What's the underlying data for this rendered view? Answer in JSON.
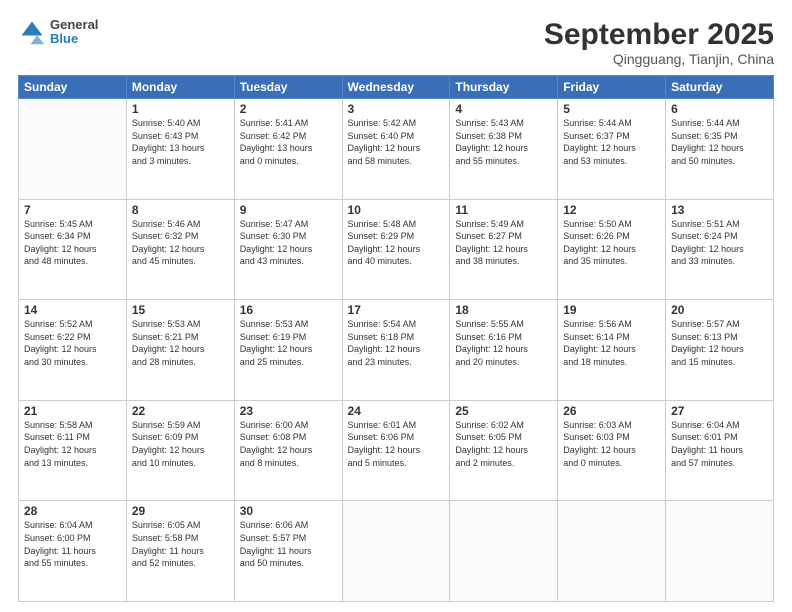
{
  "header": {
    "logo_line1": "General",
    "logo_line2": "Blue",
    "month": "September 2025",
    "location": "Qingguang, Tianjin, China"
  },
  "weekdays": [
    "Sunday",
    "Monday",
    "Tuesday",
    "Wednesday",
    "Thursday",
    "Friday",
    "Saturday"
  ],
  "weeks": [
    [
      {
        "day": "",
        "info": ""
      },
      {
        "day": "1",
        "info": "Sunrise: 5:40 AM\nSunset: 6:43 PM\nDaylight: 13 hours\nand 3 minutes."
      },
      {
        "day": "2",
        "info": "Sunrise: 5:41 AM\nSunset: 6:42 PM\nDaylight: 13 hours\nand 0 minutes."
      },
      {
        "day": "3",
        "info": "Sunrise: 5:42 AM\nSunset: 6:40 PM\nDaylight: 12 hours\nand 58 minutes."
      },
      {
        "day": "4",
        "info": "Sunrise: 5:43 AM\nSunset: 6:38 PM\nDaylight: 12 hours\nand 55 minutes."
      },
      {
        "day": "5",
        "info": "Sunrise: 5:44 AM\nSunset: 6:37 PM\nDaylight: 12 hours\nand 53 minutes."
      },
      {
        "day": "6",
        "info": "Sunrise: 5:44 AM\nSunset: 6:35 PM\nDaylight: 12 hours\nand 50 minutes."
      }
    ],
    [
      {
        "day": "7",
        "info": "Sunrise: 5:45 AM\nSunset: 6:34 PM\nDaylight: 12 hours\nand 48 minutes."
      },
      {
        "day": "8",
        "info": "Sunrise: 5:46 AM\nSunset: 6:32 PM\nDaylight: 12 hours\nand 45 minutes."
      },
      {
        "day": "9",
        "info": "Sunrise: 5:47 AM\nSunset: 6:30 PM\nDaylight: 12 hours\nand 43 minutes."
      },
      {
        "day": "10",
        "info": "Sunrise: 5:48 AM\nSunset: 6:29 PM\nDaylight: 12 hours\nand 40 minutes."
      },
      {
        "day": "11",
        "info": "Sunrise: 5:49 AM\nSunset: 6:27 PM\nDaylight: 12 hours\nand 38 minutes."
      },
      {
        "day": "12",
        "info": "Sunrise: 5:50 AM\nSunset: 6:26 PM\nDaylight: 12 hours\nand 35 minutes."
      },
      {
        "day": "13",
        "info": "Sunrise: 5:51 AM\nSunset: 6:24 PM\nDaylight: 12 hours\nand 33 minutes."
      }
    ],
    [
      {
        "day": "14",
        "info": "Sunrise: 5:52 AM\nSunset: 6:22 PM\nDaylight: 12 hours\nand 30 minutes."
      },
      {
        "day": "15",
        "info": "Sunrise: 5:53 AM\nSunset: 6:21 PM\nDaylight: 12 hours\nand 28 minutes."
      },
      {
        "day": "16",
        "info": "Sunrise: 5:53 AM\nSunset: 6:19 PM\nDaylight: 12 hours\nand 25 minutes."
      },
      {
        "day": "17",
        "info": "Sunrise: 5:54 AM\nSunset: 6:18 PM\nDaylight: 12 hours\nand 23 minutes."
      },
      {
        "day": "18",
        "info": "Sunrise: 5:55 AM\nSunset: 6:16 PM\nDaylight: 12 hours\nand 20 minutes."
      },
      {
        "day": "19",
        "info": "Sunrise: 5:56 AM\nSunset: 6:14 PM\nDaylight: 12 hours\nand 18 minutes."
      },
      {
        "day": "20",
        "info": "Sunrise: 5:57 AM\nSunset: 6:13 PM\nDaylight: 12 hours\nand 15 minutes."
      }
    ],
    [
      {
        "day": "21",
        "info": "Sunrise: 5:58 AM\nSunset: 6:11 PM\nDaylight: 12 hours\nand 13 minutes."
      },
      {
        "day": "22",
        "info": "Sunrise: 5:59 AM\nSunset: 6:09 PM\nDaylight: 12 hours\nand 10 minutes."
      },
      {
        "day": "23",
        "info": "Sunrise: 6:00 AM\nSunset: 6:08 PM\nDaylight: 12 hours\nand 8 minutes."
      },
      {
        "day": "24",
        "info": "Sunrise: 6:01 AM\nSunset: 6:06 PM\nDaylight: 12 hours\nand 5 minutes."
      },
      {
        "day": "25",
        "info": "Sunrise: 6:02 AM\nSunset: 6:05 PM\nDaylight: 12 hours\nand 2 minutes."
      },
      {
        "day": "26",
        "info": "Sunrise: 6:03 AM\nSunset: 6:03 PM\nDaylight: 12 hours\nand 0 minutes."
      },
      {
        "day": "27",
        "info": "Sunrise: 6:04 AM\nSunset: 6:01 PM\nDaylight: 11 hours\nand 57 minutes."
      }
    ],
    [
      {
        "day": "28",
        "info": "Sunrise: 6:04 AM\nSunset: 6:00 PM\nDaylight: 11 hours\nand 55 minutes."
      },
      {
        "day": "29",
        "info": "Sunrise: 6:05 AM\nSunset: 5:58 PM\nDaylight: 11 hours\nand 52 minutes."
      },
      {
        "day": "30",
        "info": "Sunrise: 6:06 AM\nSunset: 5:57 PM\nDaylight: 11 hours\nand 50 minutes."
      },
      {
        "day": "",
        "info": ""
      },
      {
        "day": "",
        "info": ""
      },
      {
        "day": "",
        "info": ""
      },
      {
        "day": "",
        "info": ""
      }
    ]
  ]
}
